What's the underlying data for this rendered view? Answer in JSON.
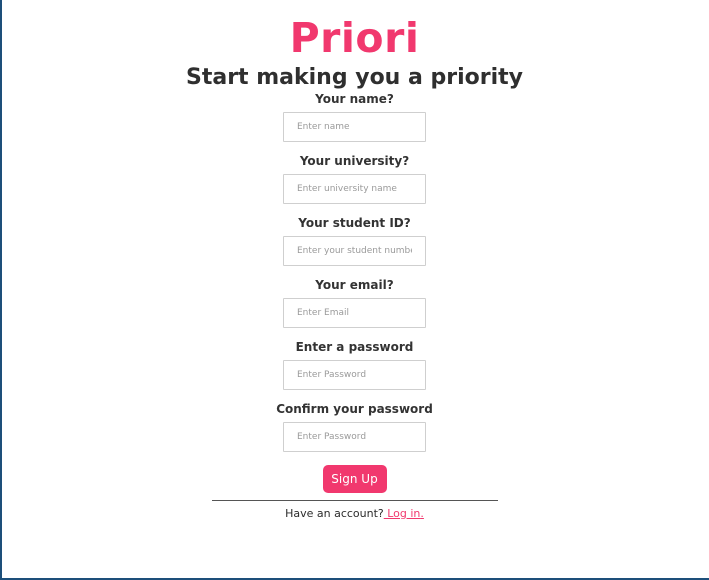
{
  "brand": {
    "title": "Priori",
    "color": "#f1386e"
  },
  "header": {
    "tagline": "Start making you a priority"
  },
  "form": {
    "fields": [
      {
        "label": "Your name?",
        "placeholder": "Enter name",
        "type": "text"
      },
      {
        "label": "Your university?",
        "placeholder": "Enter university name",
        "type": "text"
      },
      {
        "label": "Your student ID?",
        "placeholder": "Enter your student number",
        "type": "text"
      },
      {
        "label": "Your email?",
        "placeholder": "Enter Email",
        "type": "email"
      },
      {
        "label": "Enter a password",
        "placeholder": "Enter Password",
        "type": "password"
      },
      {
        "label": "Confirm your password",
        "placeholder": "Enter Password",
        "type": "password"
      }
    ],
    "submit_label": "Sign Up"
  },
  "footer": {
    "prompt": "Have an account?",
    "login_link": " Log in",
    "suffix": "."
  }
}
